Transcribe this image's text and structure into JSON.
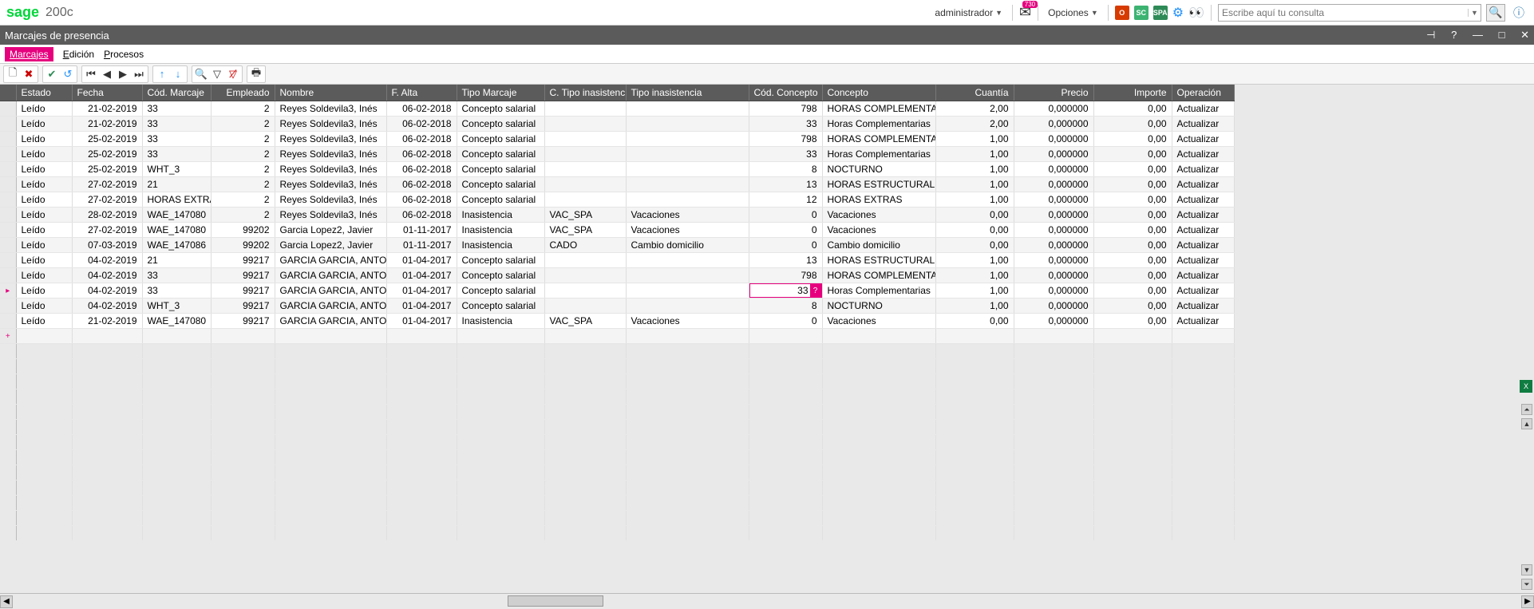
{
  "app": {
    "logo1": "sage",
    "logo2": "200c"
  },
  "top": {
    "user": "administrador",
    "mail_badge": "730",
    "options": "Opciones",
    "search_placeholder": "Escribe aquí tu consulta"
  },
  "badges": {
    "o365": "O",
    "sc": "SC",
    "spa": "SPA"
  },
  "window": {
    "title": "Marcajes de presencia"
  },
  "menu": {
    "marcajes": "Marcajes",
    "edicion": "Edición",
    "procesos": "Procesos"
  },
  "columns": {
    "estado": "Estado",
    "fecha": "Fecha",
    "cod_marcaje": "Cód. Marcaje",
    "empleado": "Empleado",
    "nombre": "Nombre",
    "f_alta": "F. Alta",
    "tipo_marcaje": "Tipo Marcaje",
    "c_tipo_inasistencia": "C. Tipo inasistencia",
    "tipo_inasistencia": "Tipo inasistencia",
    "cod_concepto": "Cód. Concepto",
    "concepto": "Concepto",
    "cuantia": "Cuantía",
    "precio": "Precio",
    "importe": "Importe",
    "operacion": "Operación"
  },
  "rows": [
    {
      "estado": "Leído",
      "fecha": "21-02-2019",
      "cod_marcaje": "33",
      "empleado": "2",
      "nombre": "Reyes Soldevila3, Inés",
      "f_alta": "06-02-2018",
      "tipo_marcaje": "Concepto salarial",
      "c_ina": "",
      "t_ina": "",
      "cod_concepto": "798",
      "concepto": "HORAS COMPLEMENTARIAS",
      "cuantia": "2,00",
      "precio": "0,000000",
      "importe": "0,00",
      "operacion": "Actualizar"
    },
    {
      "estado": "Leído",
      "fecha": "21-02-2019",
      "cod_marcaje": "33",
      "empleado": "2",
      "nombre": "Reyes Soldevila3, Inés",
      "f_alta": "06-02-2018",
      "tipo_marcaje": "Concepto salarial",
      "c_ina": "",
      "t_ina": "",
      "cod_concepto": "33",
      "concepto": "Horas Complementarias",
      "cuantia": "2,00",
      "precio": "0,000000",
      "importe": "0,00",
      "operacion": "Actualizar"
    },
    {
      "estado": "Leído",
      "fecha": "25-02-2019",
      "cod_marcaje": "33",
      "empleado": "2",
      "nombre": "Reyes Soldevila3, Inés",
      "f_alta": "06-02-2018",
      "tipo_marcaje": "Concepto salarial",
      "c_ina": "",
      "t_ina": "",
      "cod_concepto": "798",
      "concepto": "HORAS COMPLEMENTARIAS",
      "cuantia": "1,00",
      "precio": "0,000000",
      "importe": "0,00",
      "operacion": "Actualizar"
    },
    {
      "estado": "Leído",
      "fecha": "25-02-2019",
      "cod_marcaje": "33",
      "empleado": "2",
      "nombre": "Reyes Soldevila3, Inés",
      "f_alta": "06-02-2018",
      "tipo_marcaje": "Concepto salarial",
      "c_ina": "",
      "t_ina": "",
      "cod_concepto": "33",
      "concepto": "Horas Complementarias",
      "cuantia": "1,00",
      "precio": "0,000000",
      "importe": "0,00",
      "operacion": "Actualizar"
    },
    {
      "estado": "Leído",
      "fecha": "25-02-2019",
      "cod_marcaje": "WHT_3",
      "empleado": "2",
      "nombre": "Reyes Soldevila3, Inés",
      "f_alta": "06-02-2018",
      "tipo_marcaje": "Concepto salarial",
      "c_ina": "",
      "t_ina": "",
      "cod_concepto": "8",
      "concepto": "NOCTURNO",
      "cuantia": "1,00",
      "precio": "0,000000",
      "importe": "0,00",
      "operacion": "Actualizar"
    },
    {
      "estado": "Leído",
      "fecha": "27-02-2019",
      "cod_marcaje": "21",
      "empleado": "2",
      "nombre": "Reyes Soldevila3, Inés",
      "f_alta": "06-02-2018",
      "tipo_marcaje": "Concepto salarial",
      "c_ina": "",
      "t_ina": "",
      "cod_concepto": "13",
      "concepto": "HORAS ESTRUCTURALES",
      "cuantia": "1,00",
      "precio": "0,000000",
      "importe": "0,00",
      "operacion": "Actualizar"
    },
    {
      "estado": "Leído",
      "fecha": "27-02-2019",
      "cod_marcaje": "HORAS EXTRAS",
      "empleado": "2",
      "nombre": "Reyes Soldevila3, Inés",
      "f_alta": "06-02-2018",
      "tipo_marcaje": "Concepto salarial",
      "c_ina": "",
      "t_ina": "",
      "cod_concepto": "12",
      "concepto": "HORAS EXTRAS",
      "cuantia": "1,00",
      "precio": "0,000000",
      "importe": "0,00",
      "operacion": "Actualizar"
    },
    {
      "estado": "Leído",
      "fecha": "28-02-2019",
      "cod_marcaje": "WAE_147080",
      "empleado": "2",
      "nombre": "Reyes Soldevila3, Inés",
      "f_alta": "06-02-2018",
      "tipo_marcaje": "Inasistencia",
      "c_ina": "VAC_SPA",
      "t_ina": "Vacaciones",
      "cod_concepto": "0",
      "concepto": "Vacaciones",
      "cuantia": "0,00",
      "precio": "0,000000",
      "importe": "0,00",
      "operacion": "Actualizar"
    },
    {
      "estado": "Leído",
      "fecha": "27-02-2019",
      "cod_marcaje": "WAE_147080",
      "empleado": "99202",
      "nombre": "Garcia Lopez2, Javier",
      "f_alta": "01-11-2017",
      "tipo_marcaje": "Inasistencia",
      "c_ina": "VAC_SPA",
      "t_ina": "Vacaciones",
      "cod_concepto": "0",
      "concepto": "Vacaciones",
      "cuantia": "0,00",
      "precio": "0,000000",
      "importe": "0,00",
      "operacion": "Actualizar"
    },
    {
      "estado": "Leído",
      "fecha": "07-03-2019",
      "cod_marcaje": "WAE_147086",
      "empleado": "99202",
      "nombre": "Garcia Lopez2, Javier",
      "f_alta": "01-11-2017",
      "tipo_marcaje": "Inasistencia",
      "c_ina": "CADO",
      "t_ina": "Cambio domicilio",
      "cod_concepto": "0",
      "concepto": "Cambio domicilio",
      "cuantia": "0,00",
      "precio": "0,000000",
      "importe": "0,00",
      "operacion": "Actualizar"
    },
    {
      "estado": "Leído",
      "fecha": "04-02-2019",
      "cod_marcaje": "21",
      "empleado": "99217",
      "nombre": "GARCIA GARCIA, ANTONIO",
      "f_alta": "01-04-2017",
      "tipo_marcaje": "Concepto salarial",
      "c_ina": "",
      "t_ina": "",
      "cod_concepto": "13",
      "concepto": "HORAS ESTRUCTURALES",
      "cuantia": "1,00",
      "precio": "0,000000",
      "importe": "0,00",
      "operacion": "Actualizar"
    },
    {
      "estado": "Leído",
      "fecha": "04-02-2019",
      "cod_marcaje": "33",
      "empleado": "99217",
      "nombre": "GARCIA GARCIA, ANTONIO",
      "f_alta": "01-04-2017",
      "tipo_marcaje": "Concepto salarial",
      "c_ina": "",
      "t_ina": "",
      "cod_concepto": "798",
      "concepto": "HORAS COMPLEMENTARIAS",
      "cuantia": "1,00",
      "precio": "0,000000",
      "importe": "0,00",
      "operacion": "Actualizar"
    },
    {
      "estado": "Leído",
      "fecha": "04-02-2019",
      "cod_marcaje": "33",
      "empleado": "99217",
      "nombre": "GARCIA GARCIA, ANTONIO",
      "f_alta": "01-04-2017",
      "tipo_marcaje": "Concepto salarial",
      "c_ina": "",
      "t_ina": "",
      "cod_concepto": "33",
      "concepto": "Horas Complementarias",
      "cuantia": "1,00",
      "precio": "0,000000",
      "importe": "0,00",
      "operacion": "Actualizar",
      "hilite": true,
      "marker": "▸"
    },
    {
      "estado": "Leído",
      "fecha": "04-02-2019",
      "cod_marcaje": "WHT_3",
      "empleado": "99217",
      "nombre": "GARCIA GARCIA, ANTONIO",
      "f_alta": "01-04-2017",
      "tipo_marcaje": "Concepto salarial",
      "c_ina": "",
      "t_ina": "",
      "cod_concepto": "8",
      "concepto": "NOCTURNO",
      "cuantia": "1,00",
      "precio": "0,000000",
      "importe": "0,00",
      "operacion": "Actualizar"
    },
    {
      "estado": "Leído",
      "fecha": "21-02-2019",
      "cod_marcaje": "WAE_147080",
      "empleado": "99217",
      "nombre": "GARCIA GARCIA, ANTONIO",
      "f_alta": "01-04-2017",
      "tipo_marcaje": "Inasistencia",
      "c_ina": "VAC_SPA",
      "t_ina": "Vacaciones",
      "cod_concepto": "0",
      "concepto": "Vacaciones",
      "cuantia": "0,00",
      "precio": "0,000000",
      "importe": "0,00",
      "operacion": "Actualizar"
    }
  ],
  "new_row_marker": "+",
  "hilite_q": "?"
}
